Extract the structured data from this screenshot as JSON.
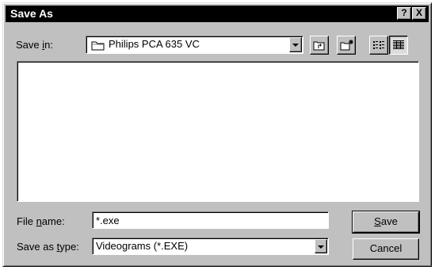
{
  "window": {
    "title": "Save As"
  },
  "title_buttons": {
    "help": "?",
    "close": "X"
  },
  "save_in": {
    "label_pre": "Save ",
    "label_key": "i",
    "label_post": "n:",
    "value": "Philips PCA 635 VC",
    "folder_icon": "folder-icon"
  },
  "toolbar": {
    "items": [
      "up-one-level-icon",
      "create-new-folder-icon",
      "list-view-icon",
      "details-view-icon"
    ]
  },
  "file_list": {
    "items": []
  },
  "file_name": {
    "label_pre": "File ",
    "label_key": "n",
    "label_post": "ame:",
    "value": "*.exe"
  },
  "save_as_type": {
    "label_pre": "Save as ",
    "label_key": "t",
    "label_post": "ype:",
    "value": "Videograms (*.EXE)"
  },
  "buttons": {
    "save_key": "S",
    "save_rest": "ave",
    "cancel": "Cancel"
  }
}
